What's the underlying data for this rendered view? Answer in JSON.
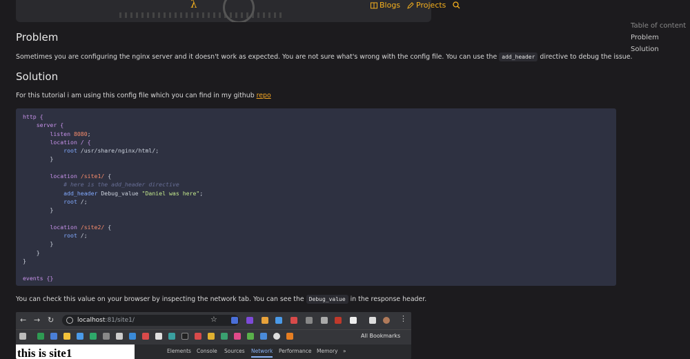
{
  "nav": {
    "logo": "λ",
    "blogs": "Blogs",
    "projects": "Projects",
    "accent": "#f5b01e"
  },
  "toc": {
    "title": "Table of content",
    "items": [
      "Problem",
      "Solution"
    ]
  },
  "problem": {
    "heading": "Problem",
    "text_before": "Sometimes you are configuring the nginx server and it doesn't work as expected. You are not sure what's wrong with the config file. You can use the ",
    "code": "add_header",
    "text_after": " directive to debug the issue."
  },
  "solution": {
    "heading": "Solution",
    "text_before": "For this tutorial i am using this config file which you can find in my github ",
    "link": "repo"
  },
  "code_lines": {
    "l1": "http {",
    "l2": "    server {",
    "l3_kw": "listen",
    "l3_num": "8080",
    "l4_kw": "location",
    "l4_rest": " / {",
    "l5_kw": "root",
    "l5_rest": " /usr/share/nginx/html/;",
    "l8_kw": "location",
    "l8_path": "/site1/",
    "l9": "# here is the add_header directive",
    "l10_kw": "add_header",
    "l10_name": " Debug_value ",
    "l10_str": "\"Daniel was here\"",
    "l11_kw": "root",
    "l11_rest": " /;",
    "l14_kw": "location",
    "l14_path": "/site2/",
    "l15_kw": "root",
    "l15_rest": " /;",
    "l19": "events {}"
  },
  "after": {
    "text_before": "You can check this value on your browser by inspecting the network tab. You can see the ",
    "code": "Debug_value",
    "text_after": " in the response header."
  },
  "screenshot": {
    "url_host": "localhost",
    "url_rest": ":81/site1/",
    "all_bookmarks": "All Bookmarks",
    "page_text": "this is site1",
    "devtools_tabs": [
      "Elements",
      "Console",
      "Sources",
      "Network",
      "Performance",
      "Memory"
    ],
    "active_tab": "Network",
    "more": "»"
  }
}
